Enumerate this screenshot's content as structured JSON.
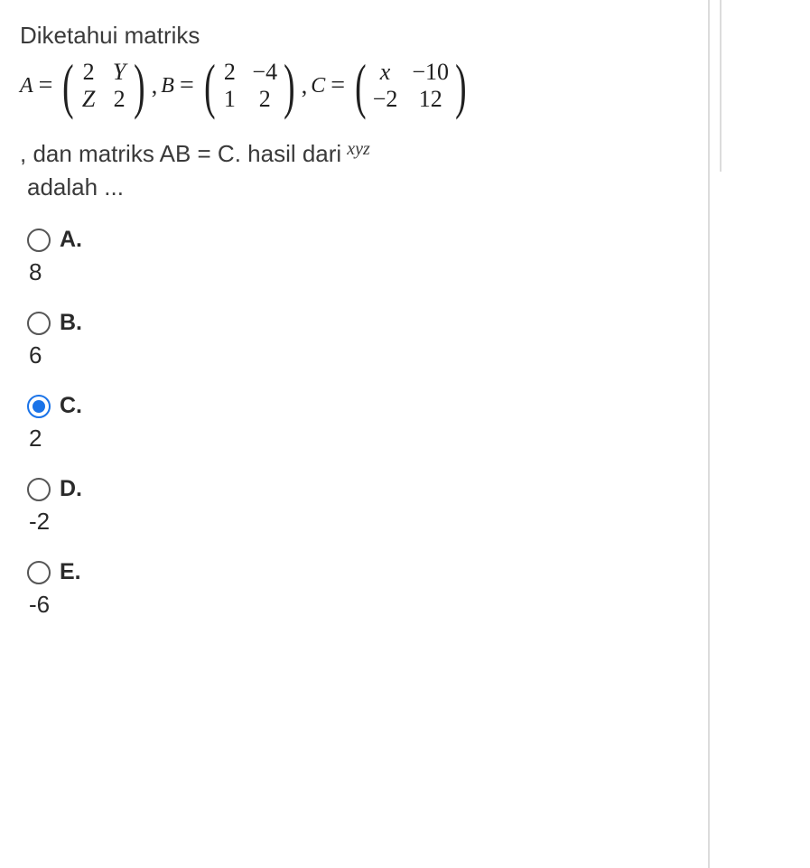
{
  "question": {
    "intro": "Diketahui matriks",
    "A_label": "A",
    "B_label": "B",
    "C_label": "C",
    "eq_sign": "=",
    "comma_B": ",",
    "comma_C": ",",
    "mA": {
      "r1c1": "2",
      "r1c2": "Y",
      "r2c1": "Z",
      "r2c2": "2"
    },
    "mB": {
      "r1c1": "2",
      "r1c2": "−4",
      "r2c1": "1",
      "r2c2": "2"
    },
    "mC": {
      "r1c1": "x",
      "r1c2": "−10",
      "r2c1": "−2",
      "r2c2": "12"
    },
    "line2_prefix": ", dan matriks AB = C. hasil dari",
    "line2_sup": "xyz",
    "line3": "adalah ..."
  },
  "options": {
    "A": {
      "label": "A.",
      "value": "8",
      "selected": false
    },
    "B": {
      "label": "B.",
      "value": "6",
      "selected": false
    },
    "C": {
      "label": "C.",
      "value": "2",
      "selected": true
    },
    "D": {
      "label": "D.",
      "value": "-2",
      "selected": false
    },
    "E": {
      "label": "E.",
      "value": "-6",
      "selected": false
    }
  }
}
